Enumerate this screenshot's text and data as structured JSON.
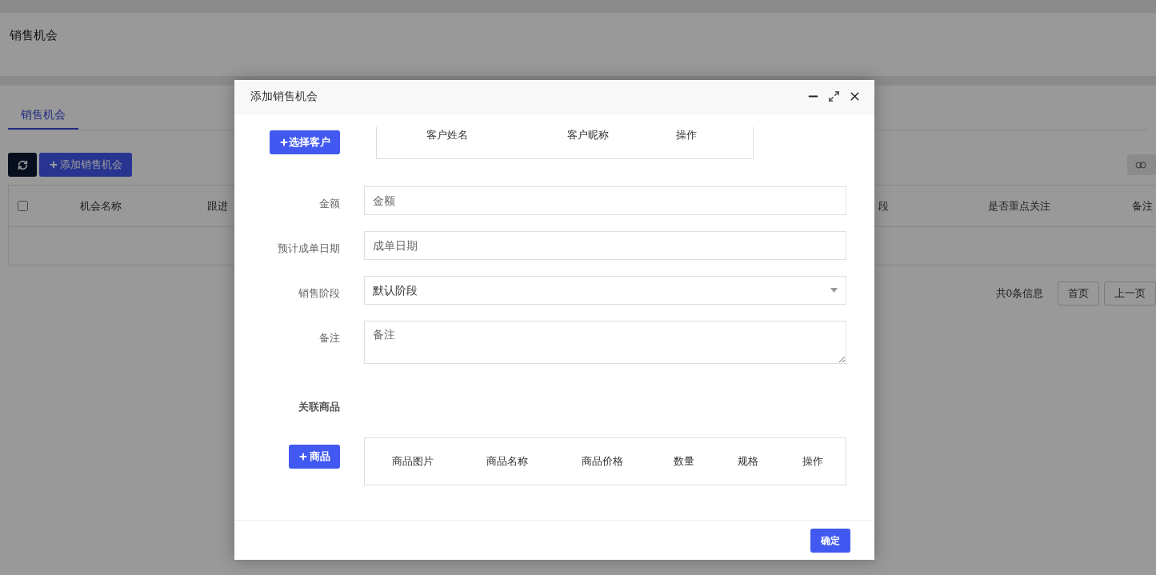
{
  "page_header": {
    "title": "销售机会"
  },
  "tabs": [
    {
      "label": "销售机会",
      "selected": true
    }
  ],
  "toolbar": {
    "add_button": "添加销售机会"
  },
  "table": {
    "select_all_checked": false,
    "columns": [
      "机会名称",
      "跟进",
      "段",
      "是否重点关注",
      "备注"
    ]
  },
  "pagination": {
    "summary": "共0条信息",
    "buttons": [
      "首页",
      "上一页"
    ]
  },
  "dialog": {
    "title": "添加销售机会",
    "select_customer_button": "选择客户",
    "customer_columns": [
      "客户姓名",
      "客户昵称",
      "操作"
    ],
    "fields": [
      {
        "label": "金额",
        "kind": "input",
        "placeholder": "金额"
      },
      {
        "label": "预计成单日期",
        "kind": "input",
        "placeholder": "成单日期"
      },
      {
        "label": "销售阶段",
        "kind": "select",
        "value": "默认阶段"
      },
      {
        "label": "备注",
        "kind": "textarea",
        "placeholder": "备注"
      }
    ],
    "products_label": "关联商品",
    "product_button": "商品",
    "product_columns": [
      "商品图片",
      "商品名称",
      "商品价格",
      "数量",
      "规格",
      "操作"
    ],
    "confirm_button": "确定"
  }
}
